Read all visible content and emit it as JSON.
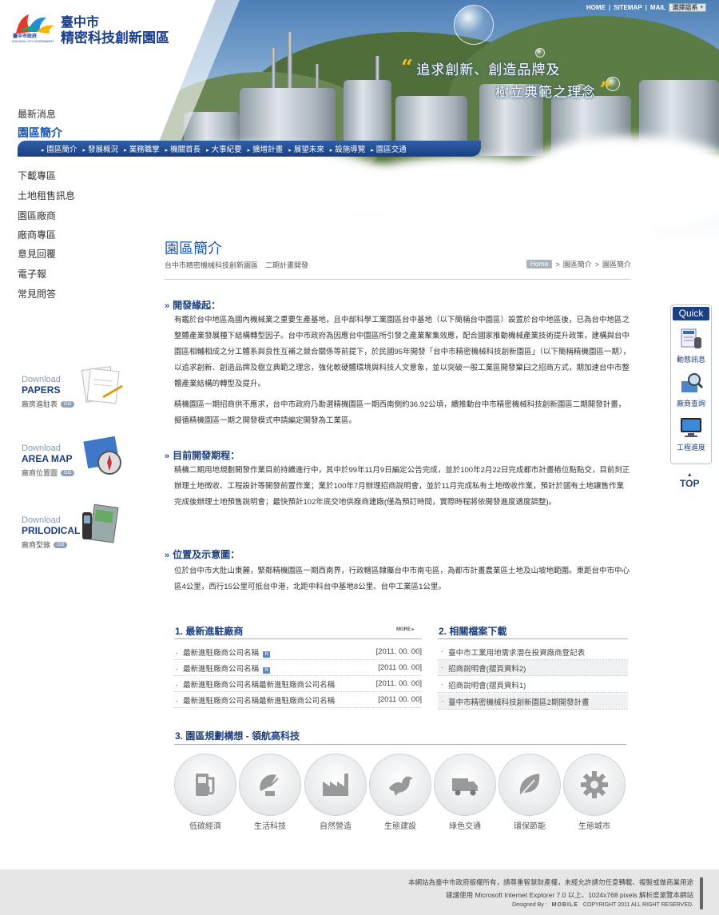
{
  "header": {
    "logo_line1": "臺中市",
    "logo_line2": "精密科技創新園區",
    "logo_seal": "臺中市政府",
    "logo_seal_en": "TAICHUNG CITY GOVERNMENT",
    "top_links": [
      "HOME",
      "SITEMAP",
      "MAIL"
    ],
    "lang_select": "選擇語系",
    "slogan_line1": "追求創新、創造品牌及",
    "slogan_line2": "樹立典範之理念"
  },
  "left_nav": {
    "items_top": [
      "最新消息"
    ],
    "active": "園區簡介",
    "items_bottom": [
      "下載專區",
      "土地租售訊息",
      "園區廠商",
      "廠商專區",
      "意見回覆",
      "電子報",
      "常見問答"
    ]
  },
  "sub_nav": [
    "園區簡介",
    "發展概況",
    "業務職掌",
    "機關首長",
    "大事紀要",
    "擴增計畫",
    "展望未來",
    "設施導覽",
    "園區交通"
  ],
  "page": {
    "title": "園區簡介",
    "subtitle": "台中市精密機械科技創新園區　二期計畫開發",
    "breadcrumb": [
      "Home",
      "園區簡介",
      "園區簡介"
    ]
  },
  "sections": [
    {
      "heading": "開發緣起：",
      "paragraphs": [
        "有鑑於台中地區為國內機械業之重要生產基地，且中部科學工業園區台中基地（以下簡稱台中園區）設置於台中地區後，已為台中地區之整體產業發展種下結構轉型因子。台中市政府為因應台中園區所引發之產業聚集效應，配合國家推動機械產業技術提升政策，建構與台中園區相輔相成之分工體系與良性互補之競合關係等前提下，於民國95年開發「台中市精密機械科技創新園區」（以下簡稱精機園區一期），以追求創新、創造品牌及樹立典範之理念，強化軟硬體環境與科技人文意象，並以突破一般工業區開發窠臼之招商方式，期加速台中市整體產業結構的轉型及提升。",
        "精機園區一期招商供不應求，台中市政府乃勘選精機園區一期西南側約36.92公頃，續推動台中市精密機械科技創新園區二期開發計畫，擬循精機園區一期之開發模式申請編定開發為工業區。"
      ]
    },
    {
      "heading": "目前開發期程：",
      "paragraphs": [
        "精機二期用地規劃開發作業目前持續進行中，其中於99年11月9日編定公告完成，並於100年2月22日完成都市計畫樁位點點交，目前刻正辦理土地徵收、工程設計等開發前置作業；業於100年7月辦理招商說明會，並於11月完成私有土地徵收作業，預計於國有土地讓售作業完成後辦理土地預售說明會；最快預計102年底交地供廠商建廠(僅為預訂時間，實際時程將依開發進度適度調整)。"
      ]
    },
    {
      "heading": "位置及示意圖：",
      "paragraphs": [
        "位於台中市大肚山東麓，緊鄰精機園區一期西南界，行政轄區隸屬台中市南屯區，為都市計畫農業區土地及山坡地範圍。東距台中市中心區4公里，西行15公里可抵台中港，北距中科台中基地8公里、台中工業區1公里。"
      ]
    }
  ],
  "news": {
    "heading": "1. 最新進駐廠商",
    "more": "MORE",
    "new_badge": "N",
    "rows": [
      {
        "title": "最新進駐廠商公司名稱",
        "new": true,
        "date": "[2011. 00. 00]"
      },
      {
        "title": "最新進駐廠商公司名稱",
        "new": true,
        "date": "[2011 00. 00]"
      },
      {
        "title": "最新進駐廠商公司名稱最新進駐廠商公司名稱",
        "new": false,
        "date": "[2011. 00. 00]"
      },
      {
        "title": "最新進駐廠商公司名稱最新進駐廠商公司名稱",
        "new": false,
        "date": "[2011 00. 00]"
      }
    ]
  },
  "downloads": {
    "heading": "2. 相關檔案下載",
    "rows": [
      "臺中市工業用地需求潛在投資廠商登記表",
      "招商說明會(摺頁資料2)",
      "招商說明會(摺頁資料1)",
      "臺中市精密機械科技創新園區2期開發計畫"
    ]
  },
  "planning": {
    "heading": "3. 園區規劃構想 - 領航高科技",
    "items": [
      {
        "label": "低碳經濟",
        "icon": "fuel-pump-icon"
      },
      {
        "label": "生活科技",
        "icon": "satellite-dish-icon"
      },
      {
        "label": "自然營造",
        "icon": "factory-icon"
      },
      {
        "label": "生態建設",
        "icon": "bird-icon"
      },
      {
        "label": "綠色交通",
        "icon": "truck-icon"
      },
      {
        "label": "環保節能",
        "icon": "leaf-icon"
      },
      {
        "label": "生態城市",
        "icon": "gear-icon"
      }
    ]
  },
  "download_side": [
    {
      "small": "Download",
      "big": "PAPERS",
      "sub": "廠房進駐表",
      "go": "GO"
    },
    {
      "small": "Download",
      "big": "AREA MAP",
      "sub": "廠商位置圖",
      "go": "GO"
    },
    {
      "small": "Download",
      "big": "PRILODICAL",
      "sub": "廠商型錄",
      "go": "GO"
    }
  ],
  "quick": {
    "heading": "Quick",
    "items": [
      "動態訊息",
      "廠商查詢",
      "工程進度"
    ],
    "top": "TOP"
  },
  "footer": {
    "line1": "本網站為臺中市政府版權所有，請尊重智慧財產權，未經允許請勿任意轉載、複製或做商業用途",
    "line2": "建議使用 Microsoft Internet Explorer 7.0 以上、1024x768 pixels 解析度瀏覽本網站",
    "designed_by": "Designed By :",
    "designer": "MOBILE",
    "copyright": "COPYRIGHT 2011 ALL RIGHT RESERVED."
  },
  "colors": {
    "brand_blue": "#1d56a8",
    "nav_bar": "#1c3f84"
  }
}
